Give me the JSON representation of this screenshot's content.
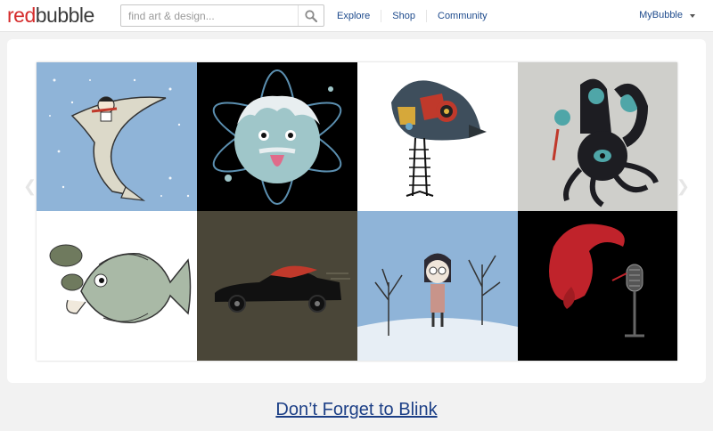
{
  "header": {
    "logo_red": "red",
    "logo_dark": "bubble",
    "search_placeholder": "find art & design...",
    "nav": [
      "Explore",
      "Shop",
      "Community"
    ],
    "account_label": "MyBubble"
  },
  "colors": {
    "brand_red": "#d52b2b",
    "link_blue": "#1d4a8c",
    "tile_blue": "#8fb4d8",
    "tile_black": "#000000",
    "tile_gray": "#cfcfcb",
    "tile_olive": "#4a4638"
  },
  "gallery": {
    "tiles": [
      {
        "name": "tile-kid-riding-shark",
        "bg": "#8fb4d8"
      },
      {
        "name": "tile-einstein-planet",
        "bg": "#000000"
      },
      {
        "name": "tile-robot-bird",
        "bg": "#ffffff"
      },
      {
        "name": "tile-octopus-creatures",
        "bg": "#cfcfcb"
      },
      {
        "name": "tile-smoking-fish",
        "bg": "#ffffff"
      },
      {
        "name": "tile-red-hair-car",
        "bg": "#4a4638"
      },
      {
        "name": "tile-girl-winter-trees",
        "bg": "#8fb4d8"
      },
      {
        "name": "tile-red-hair-microphone",
        "bg": "#000000"
      }
    ]
  },
  "caption": "Don’t Forget to Blink"
}
